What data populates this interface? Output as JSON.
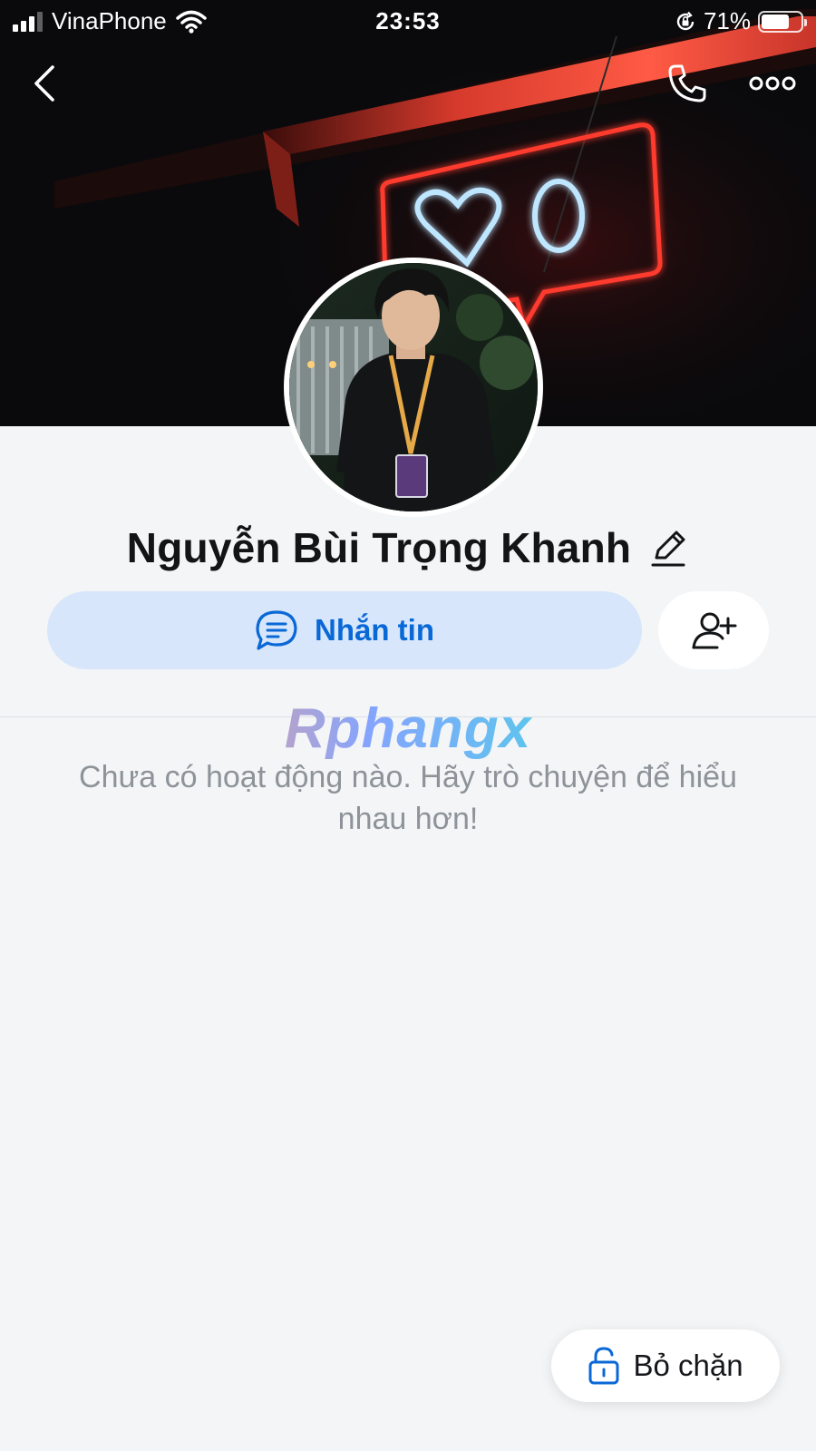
{
  "status_bar": {
    "carrier": "VinaPhone",
    "time": "23:53",
    "battery_percent": "71%",
    "battery_level": 0.71,
    "signal_bars_filled": 3,
    "signal_bars_total": 4,
    "icons": [
      "signal-icon",
      "wifi-icon",
      "orientation-lock-icon",
      "battery-icon"
    ]
  },
  "header": {
    "icons": [
      "back-icon",
      "phone-icon",
      "more-icon"
    ]
  },
  "profile": {
    "name": "Nguyễn Bùi Trọng Khanh"
  },
  "actions": {
    "message_label": "Nhắn tin",
    "message_icon": "chat-bubble-icon",
    "add_friend_icon": "add-friend-icon"
  },
  "watermark": {
    "text": "Rphangx"
  },
  "empty_state": {
    "message": "Chưa có hoạt động nào. Hãy trò chuyện để hiểu nhau hơn!"
  },
  "unblock": {
    "label": "Bỏ chặn",
    "icon": "unlock-icon"
  },
  "colors": {
    "accent": "#0a68d6",
    "message_button_bg": "#d7e6fb",
    "page_bg": "#f3f5f7",
    "neon_red": "#ff3b2f",
    "neon_blue": "#bfe6ff"
  }
}
